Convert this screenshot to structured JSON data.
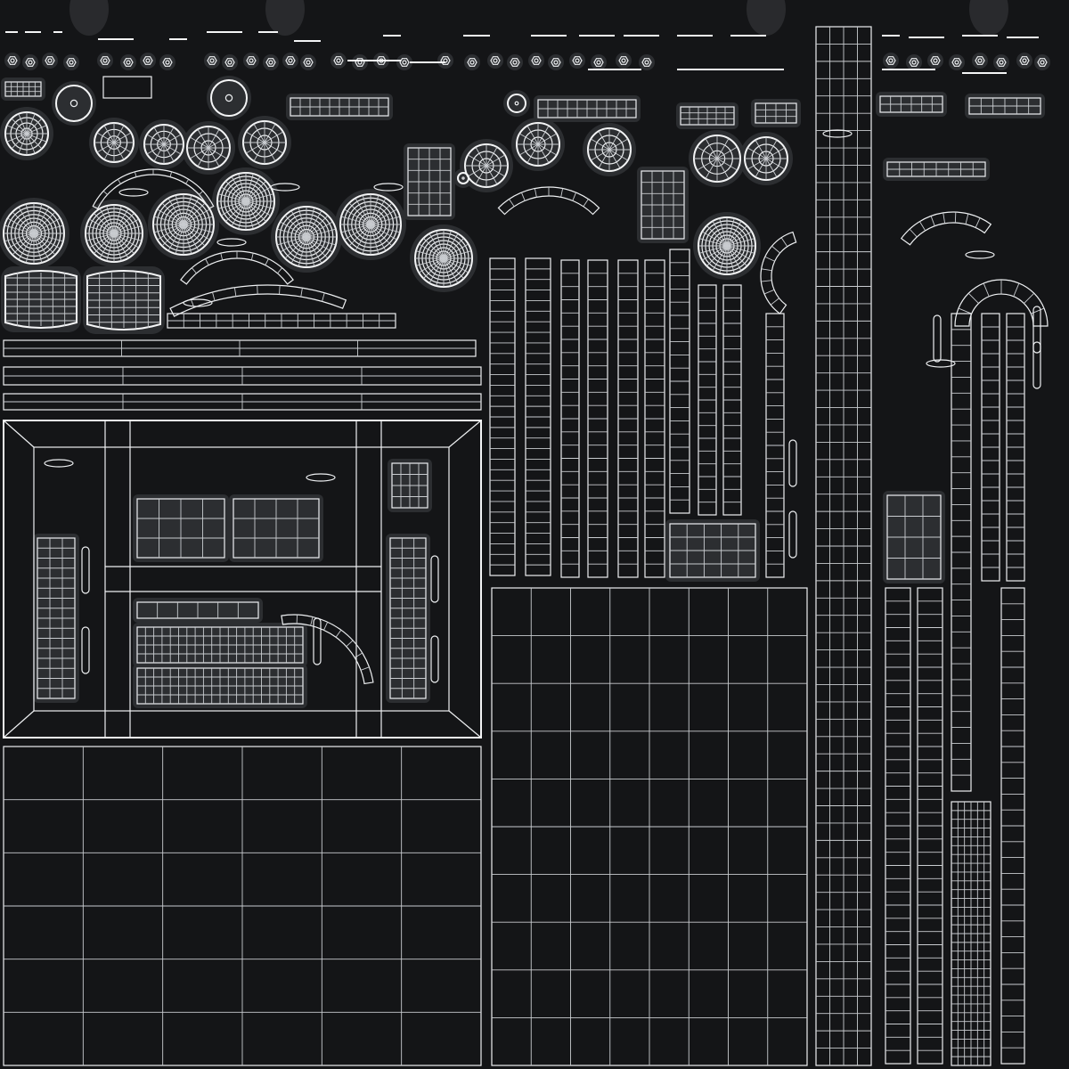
{
  "texture_sheet": {
    "background_color": "#141517",
    "wire_color": "#eef0f2",
    "island_halo_color": "#2c2e31",
    "caption": ""
  }
}
